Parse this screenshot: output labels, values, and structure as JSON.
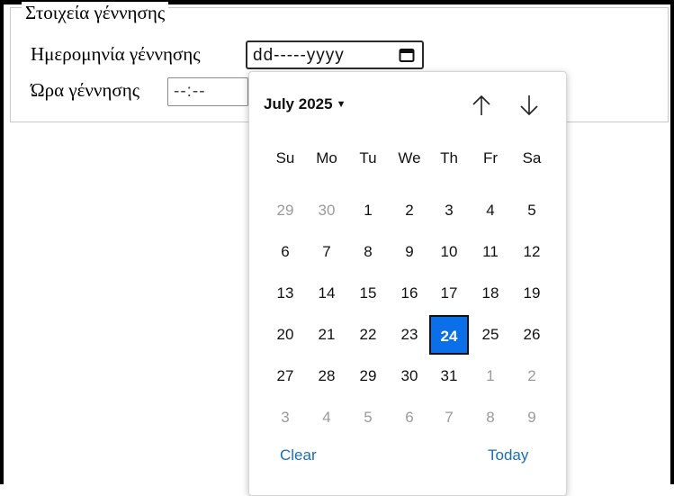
{
  "form": {
    "legend": "Στοιχεία γέννησης",
    "date_label": "Ημερομηνία γέννησης",
    "date_value": "dd-----yyyy",
    "time_label": "Ώρα γέννησης",
    "time_value": "--:--"
  },
  "picker": {
    "month_label": "July 2025",
    "weekdays": [
      "Su",
      "Mo",
      "Tu",
      "We",
      "Th",
      "Fr",
      "Sa"
    ],
    "weeks": [
      [
        {
          "d": "29",
          "other": true
        },
        {
          "d": "30",
          "other": true
        },
        {
          "d": "1"
        },
        {
          "d": "2"
        },
        {
          "d": "3"
        },
        {
          "d": "4"
        },
        {
          "d": "5"
        }
      ],
      [
        {
          "d": "6"
        },
        {
          "d": "7"
        },
        {
          "d": "8"
        },
        {
          "d": "9"
        },
        {
          "d": "10"
        },
        {
          "d": "11"
        },
        {
          "d": "12"
        }
      ],
      [
        {
          "d": "13"
        },
        {
          "d": "14"
        },
        {
          "d": "15"
        },
        {
          "d": "16"
        },
        {
          "d": "17"
        },
        {
          "d": "18"
        },
        {
          "d": "19"
        }
      ],
      [
        {
          "d": "20"
        },
        {
          "d": "21"
        },
        {
          "d": "22"
        },
        {
          "d": "23"
        },
        {
          "d": "24",
          "selected": true
        },
        {
          "d": "25"
        },
        {
          "d": "26"
        }
      ],
      [
        {
          "d": "27"
        },
        {
          "d": "28"
        },
        {
          "d": "29"
        },
        {
          "d": "30"
        },
        {
          "d": "31"
        },
        {
          "d": "1",
          "other": true
        },
        {
          "d": "2",
          "other": true
        }
      ],
      [
        {
          "d": "3",
          "other": true
        },
        {
          "d": "4",
          "other": true
        },
        {
          "d": "5",
          "other": true
        },
        {
          "d": "6",
          "other": true
        },
        {
          "d": "7",
          "other": true
        },
        {
          "d": "8",
          "other": true
        },
        {
          "d": "9",
          "other": true
        }
      ]
    ],
    "clear_label": "Clear",
    "today_label": "Today",
    "accent_color": "#0a6fe8",
    "link_color": "#1a6fb0",
    "icons": {
      "calendar": "calendar-icon",
      "up": "arrow-up-icon",
      "down": "arrow-down-icon",
      "caret": "caret-down-icon"
    }
  }
}
